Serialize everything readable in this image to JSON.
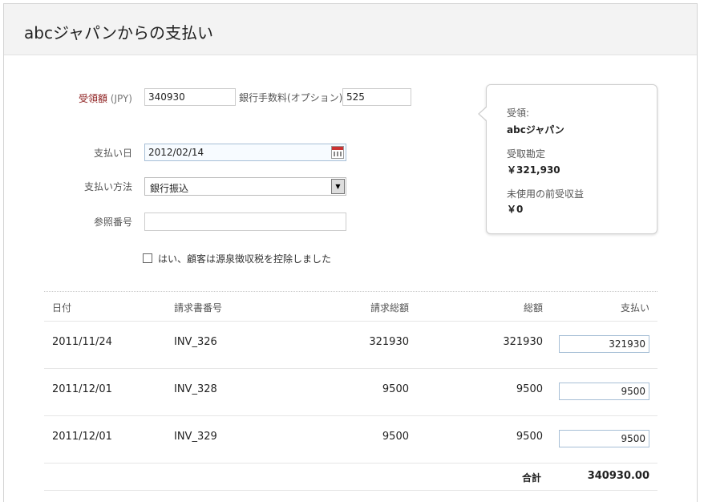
{
  "page": {
    "title": "abcジャパンからの支払い"
  },
  "form": {
    "amount_label": "受領額",
    "amount_unit": "(JPY)",
    "amount_value": "340930",
    "bank_fee_label": "銀行手数料(オプション)",
    "bank_fee_value": "525",
    "date_label": "支払い日",
    "date_value": "2012/02/14",
    "method_label": "支払い方法",
    "method_value": "銀行振込",
    "reference_label": "参照番号",
    "reference_value": "",
    "tds_checkbox_label": "はい、顧客は源泉徴収税を控除しました",
    "tds_checked": false
  },
  "summary": {
    "received_from_label": "受領:",
    "received_from_value": "abcジャパン",
    "account_label": "受取勘定",
    "account_value": "￥321,930",
    "unused_label": "未使用の前受収益",
    "unused_value": "￥0"
  },
  "table": {
    "headers": {
      "date": "日付",
      "invoice_no": "請求書番号",
      "invoice_total": "請求総額",
      "amount_due": "総額",
      "payment": "支払い"
    },
    "rows": [
      {
        "date": "2011/11/24",
        "invoice_no": "INV_326",
        "invoice_total": "321930",
        "amount_due": "321930",
        "payment": "321930"
      },
      {
        "date": "2011/12/01",
        "invoice_no": "INV_328",
        "invoice_total": "9500",
        "amount_due": "9500",
        "payment": "9500"
      },
      {
        "date": "2011/12/01",
        "invoice_no": "INV_329",
        "invoice_total": "9500",
        "amount_due": "9500",
        "payment": "9500"
      }
    ],
    "total_label": "合計",
    "total_value": "340930.00"
  }
}
